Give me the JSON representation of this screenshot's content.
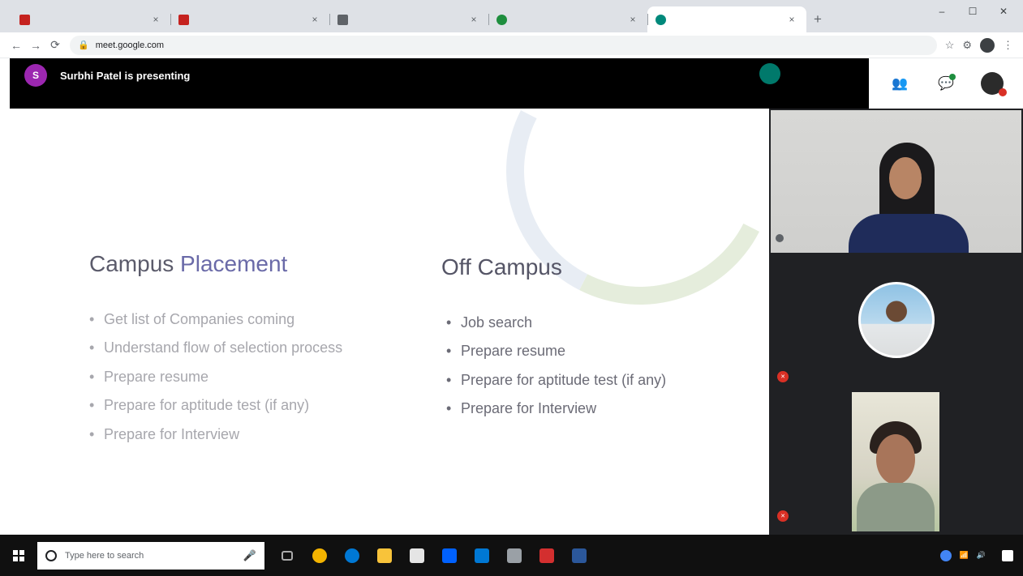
{
  "browser": {
    "tabs": [
      {
        "title": "",
        "favicon_color": "#c5221f"
      },
      {
        "title": "",
        "favicon_color": "#c5221f"
      },
      {
        "title": "",
        "favicon_color": "#5f6368"
      },
      {
        "title": "",
        "favicon_color": "#1e8e3e"
      },
      {
        "title": "",
        "favicon_color": "#00897b",
        "active": true
      }
    ],
    "address": {
      "host": "meet.google.com",
      "path": ""
    },
    "window_controls": {
      "minimize": "–",
      "maximize": "☐",
      "close": "✕"
    }
  },
  "meet": {
    "presenter_initial": "S",
    "presenting_text": "Surbhi Patel is presenting",
    "others_initial": "",
    "others_line1": "",
    "others_line2": "",
    "accent_color": "#9c27b0"
  },
  "slide": {
    "left_heading_part1": "Campus",
    "left_heading_part2": "Placement",
    "left_bullets": [
      "Get list of Companies coming",
      "Understand flow of selection process",
      "Prepare resume",
      "Prepare for aptitude test (if any)",
      "Prepare for Interview"
    ],
    "right_heading": "Off Campus",
    "right_bullets": [
      "Job search",
      "Prepare resume",
      "Prepare for aptitude test (if any)",
      "Prepare for Interview"
    ]
  },
  "participants": [
    {
      "name": "",
      "muted": false
    },
    {
      "name": "",
      "muted": true
    },
    {
      "name": "",
      "muted": true
    }
  ],
  "taskbar": {
    "search_placeholder": "Type here to search",
    "clock_time": "",
    "clock_date": ""
  },
  "colors": {
    "meet_black": "#000000",
    "side_panel": "#202124",
    "muted_red": "#d93025"
  }
}
